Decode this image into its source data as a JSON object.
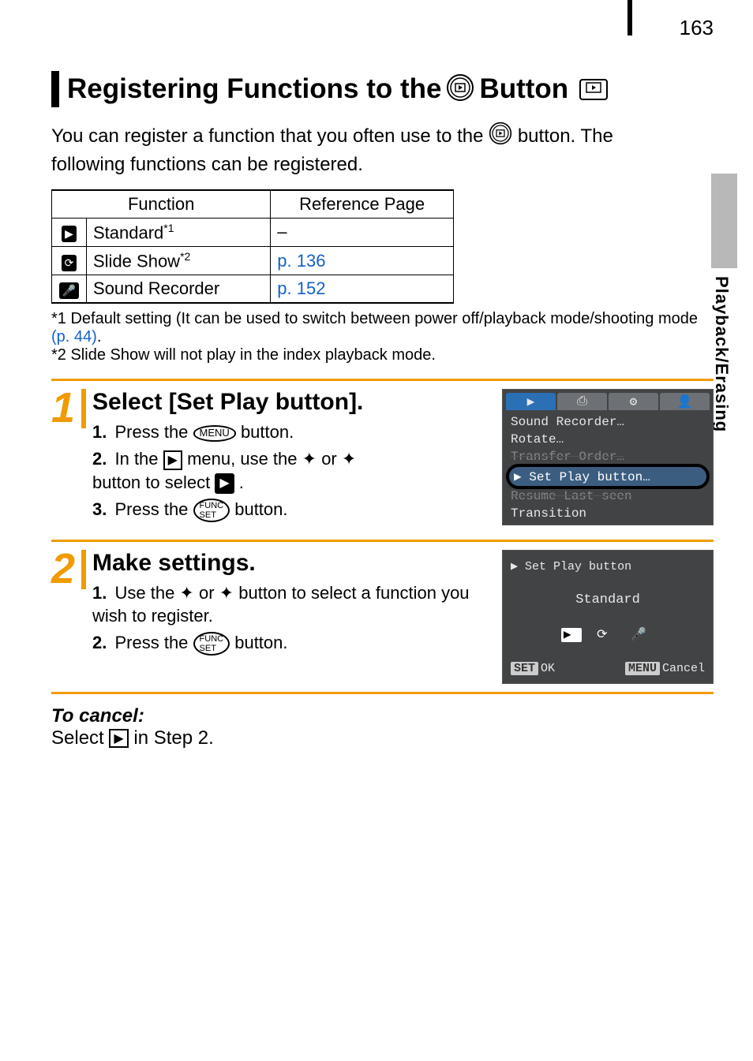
{
  "page_number": "163",
  "side_tab": "Playback/Erasing",
  "heading": {
    "prefix": "Registering Functions to the ",
    "suffix": "  Button"
  },
  "intro": {
    "line1_a": "You can register a function that you often use to the ",
    "line1_b": "  button. The",
    "line2": "following functions can be registered."
  },
  "table": {
    "h1": "Function",
    "h2": "Reference Page",
    "rows": [
      {
        "icon": "▶",
        "label": "Standard",
        "sup": "*1",
        "ref": "–",
        "ref_link": false
      },
      {
        "icon": "⟳",
        "label": "Slide Show",
        "sup": "*2",
        "ref": "p. 136",
        "ref_link": true
      },
      {
        "icon": "🎤",
        "label": "Sound Recorder",
        "sup": "",
        "ref": "p. 152",
        "ref_link": true
      }
    ]
  },
  "notes": {
    "n1a": "*1 Default setting (It can be used to switch between power off/playback mode/shooting mode ",
    "n1b": "(p. 44)",
    "n1c": ".",
    "n2": "*2 Slide Show will not play in the index playback mode."
  },
  "steps": [
    {
      "num": "1",
      "title": "Select [Set Play button].",
      "items": [
        {
          "pre": "Press the ",
          "btn": "MENU",
          "post": " button."
        },
        {
          "pre": "In the ",
          "mid": " menu, use the ",
          "post2": " or ",
          "post3": " button to select ",
          "post4": "."
        },
        {
          "pre": "Press the ",
          "btn": "FUNC SET",
          "post": " button."
        }
      ],
      "shot": {
        "rows": [
          "Sound Recorder…",
          "Rotate…",
          "Transfer Order…",
          "Set Play button…",
          "Resume        Last seen",
          "Transition"
        ],
        "hl_index": 3
      }
    },
    {
      "num": "2",
      "title": "Make settings.",
      "items": [
        {
          "pre": "Use the ",
          "mid": " or ",
          "post": " button to select a function you wish to register."
        },
        {
          "pre": "Press the ",
          "btn": "FUNC SET",
          "post": " button."
        }
      ],
      "shot2": {
        "title": "Set Play button",
        "value": "Standard",
        "ok": "OK",
        "ok_key": "SET",
        "cancel": "Cancel",
        "cancel_key": "MENU"
      }
    }
  ],
  "cancel": {
    "head": "To cancel:",
    "text_a": "Select ",
    "text_b": " in Step 2."
  }
}
